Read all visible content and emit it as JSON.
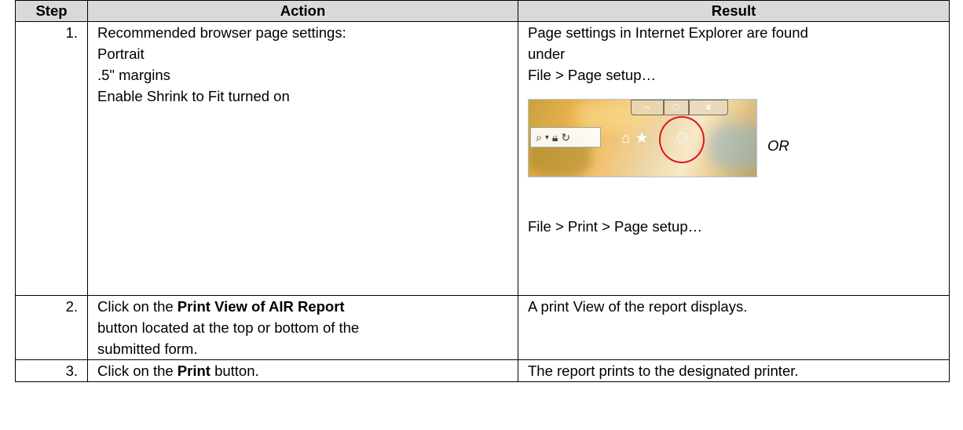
{
  "headers": {
    "step": "Step",
    "action": "Action",
    "result": "Result"
  },
  "rows": [
    {
      "step": "1.",
      "action_lines": [
        "Recommended browser page settings:",
        "Portrait",
        ".5\" margins",
        "Enable Shrink to Fit turned on"
      ],
      "result_lines": [
        "Page settings in Internet Explorer are found",
        "under",
        "File > Page setup…"
      ],
      "result_or": "OR",
      "result_after": "File > Print > Page setup…"
    },
    {
      "step": "2.",
      "action_pre": "Click on the ",
      "action_bold": "Print View of AIR Report",
      "action_lines_after": [
        "button located at the top or bottom of the",
        "submitted form."
      ],
      "result": "A print View of the report displays."
    },
    {
      "step": "3.",
      "action_pre": "Click on the ",
      "action_bold": "Print",
      "action_post": " button.",
      "result": "The report prints to the designated printer."
    }
  ],
  "screenshot": {
    "window_buttons": [
      "–",
      "□",
      "x"
    ],
    "icons": [
      "search-icon",
      "dropdown-icon",
      "lock-icon",
      "refresh-icon",
      "home-icon",
      "star-icon",
      "gear-icon"
    ],
    "highlight_color": "#e0141e"
  }
}
